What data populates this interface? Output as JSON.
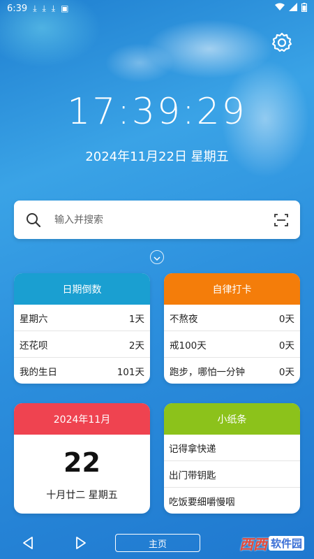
{
  "status_bar": {
    "time": "6:39",
    "icons": [
      "download-icon",
      "download-icon",
      "download-icon",
      "system-icon"
    ],
    "right_icons": [
      "wifi-icon",
      "signal-icon",
      "battery-icon"
    ]
  },
  "settings_icon": "gear-icon",
  "clock": "17:39:29",
  "date": "2024年11月22日 星期五",
  "search": {
    "placeholder": "输入并搜索",
    "icon": "search-icon",
    "scan_icon": "scan-icon"
  },
  "countdown": {
    "title": "日期倒数",
    "color": "#1a9fd1",
    "items": [
      {
        "name": "星期六",
        "days": "1天"
      },
      {
        "name": "还花呗",
        "days": "2天"
      },
      {
        "name": "我的生日",
        "days": "101天"
      }
    ]
  },
  "checkin": {
    "title": "自律打卡",
    "color": "#f47d0a",
    "items": [
      {
        "name": "不熬夜",
        "days": "0天"
      },
      {
        "name": "戒100天",
        "days": "0天"
      },
      {
        "name": "跑步，哪怕一分钟",
        "days": "0天"
      }
    ]
  },
  "calendar": {
    "title": "2024年11月",
    "color": "#ef4350",
    "day": "22",
    "lunar": "十月廿二  星期五"
  },
  "notes": {
    "title": "小纸条",
    "color": "#8cc21b",
    "items": [
      "记得拿快递",
      "出门带钥匙",
      "吃饭要细嚼慢咽"
    ]
  },
  "nav": {
    "home_label": "主页"
  },
  "watermark": {
    "text": "西西",
    "sub": "软件园"
  }
}
